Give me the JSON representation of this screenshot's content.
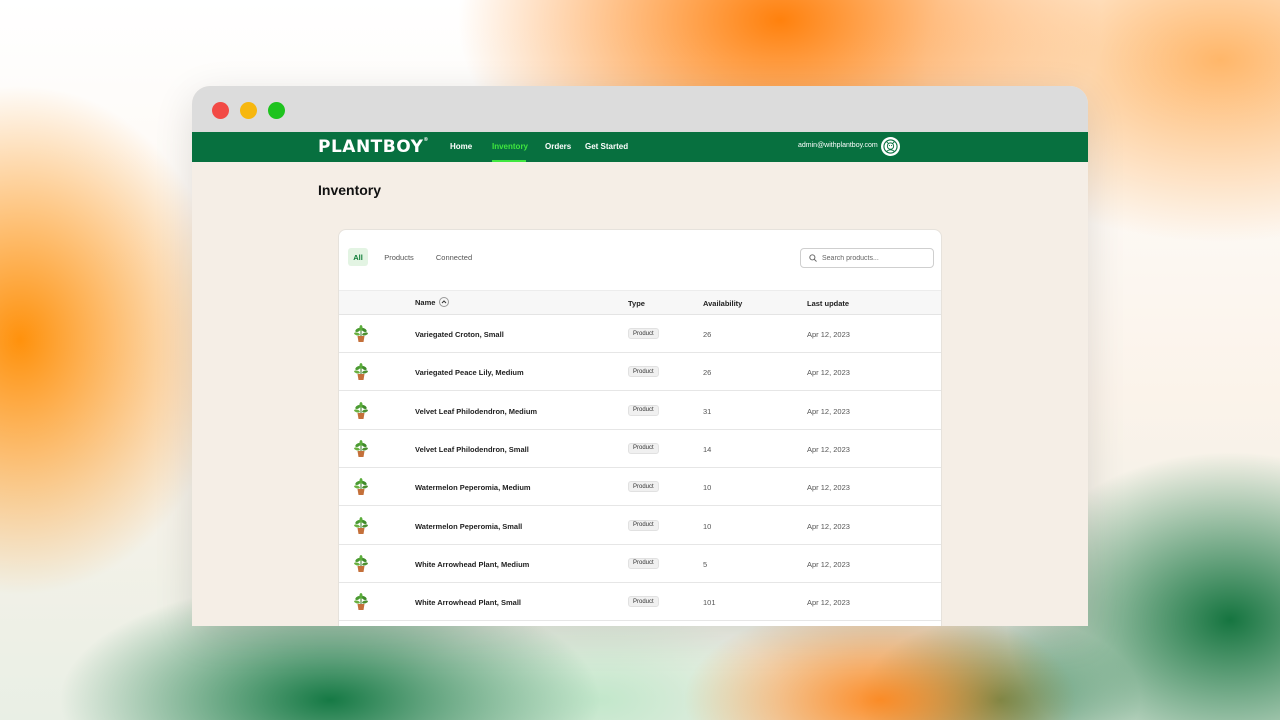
{
  "nav": {
    "logo": "PLANTBOY",
    "logo_mark": "®",
    "items": [
      {
        "label": "Home"
      },
      {
        "label": "Inventory"
      },
      {
        "label": "Orders"
      },
      {
        "label": "Get Started"
      }
    ],
    "active_item": "Inventory",
    "user_email": "admin@withplantboy.com"
  },
  "page": {
    "title": "Inventory"
  },
  "filters": {
    "tabs": [
      {
        "label": "All"
      },
      {
        "label": "Products"
      },
      {
        "label": "Connected"
      }
    ],
    "active_tab": "All"
  },
  "search": {
    "placeholder": "Search products..."
  },
  "table": {
    "columns": {
      "name": "Name",
      "type": "Type",
      "availability": "Availability",
      "last_update": "Last update"
    },
    "sort": {
      "column": "Name",
      "direction": "ascending"
    },
    "rows": [
      {
        "name": "Variegated Croton, Small",
        "type": "Product",
        "availability": "26",
        "last_update": "Apr 12, 2023",
        "image_icon": "potted-plant-icon"
      },
      {
        "name": "Variegated Peace Lily, Medium",
        "type": "Product",
        "availability": "26",
        "last_update": "Apr 12, 2023",
        "image_icon": "potted-plant-icon"
      },
      {
        "name": "Velvet Leaf Philodendron, Medium",
        "type": "Product",
        "availability": "31",
        "last_update": "Apr 12, 2023",
        "image_icon": "potted-plant-icon"
      },
      {
        "name": "Velvet Leaf Philodendron, Small",
        "type": "Product",
        "availability": "14",
        "last_update": "Apr 12, 2023",
        "image_icon": "potted-plant-icon"
      },
      {
        "name": "Watermelon Peperomia, Medium",
        "type": "Product",
        "availability": "10",
        "last_update": "Apr 12, 2023",
        "image_icon": "potted-plant-icon"
      },
      {
        "name": "Watermelon Peperomia, Small",
        "type": "Product",
        "availability": "10",
        "last_update": "Apr 12, 2023",
        "image_icon": "potted-plant-icon"
      },
      {
        "name": "White Arrowhead Plant, Medium",
        "type": "Product",
        "availability": "5",
        "last_update": "Apr 12, 2023",
        "image_icon": "potted-plant-icon"
      },
      {
        "name": "White Arrowhead Plant, Small",
        "type": "Product",
        "availability": "101",
        "last_update": "Apr 12, 2023",
        "image_icon": "potted-plant-icon"
      }
    ]
  },
  "colors": {
    "brand_green": "#07703f",
    "nav_active": "#3fe63f",
    "tab_active_bg": "#e3f4e3",
    "window_red": "#f24a45",
    "window_yellow": "#f7b70f",
    "window_green": "#1ec31e"
  }
}
